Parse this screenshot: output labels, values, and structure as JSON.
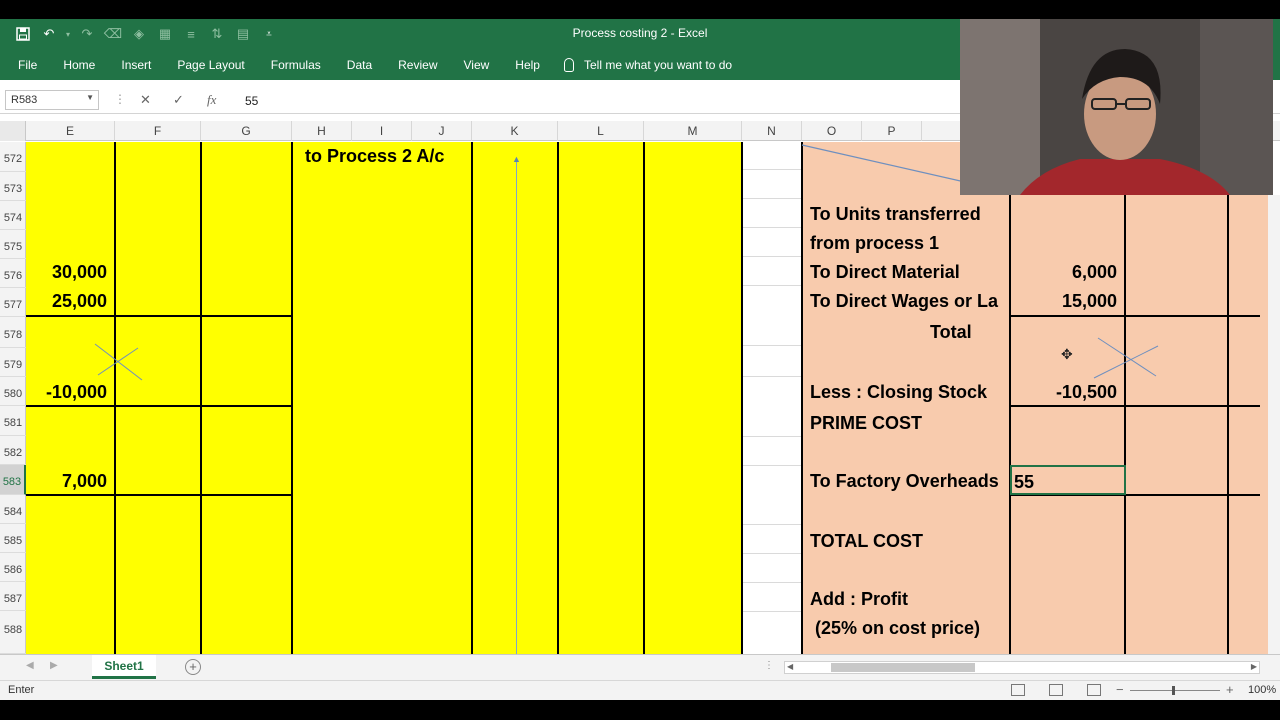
{
  "window": {
    "title": "Process costing 2  -  Excel"
  },
  "ribbon": {
    "tabs": [
      "File",
      "Home",
      "Insert",
      "Page Layout",
      "Formulas",
      "Data",
      "Review",
      "View",
      "Help"
    ],
    "tell_me": "Tell me what you want to do"
  },
  "formula_bar": {
    "name_box": "R583",
    "cancel": "✕",
    "enter": "✓",
    "fx": "fx",
    "value": "55"
  },
  "columns": [
    "E",
    "F",
    "G",
    "H",
    "I",
    "J",
    "K",
    "L",
    "M",
    "N",
    "O",
    "P"
  ],
  "rows": [
    "572",
    "573",
    "574",
    "575",
    "576",
    "577",
    "578",
    "579",
    "580",
    "581",
    "582",
    "583",
    "584",
    "585",
    "586",
    "587",
    "588"
  ],
  "left_table": {
    "heading": "to Process 2 A/c",
    "values": {
      "r576": "30,000",
      "r577": "25,000",
      "r580": "-10,000",
      "r583": "7,000"
    }
  },
  "right_table": {
    "labels": {
      "units_transferred_1": "To Units transferred",
      "units_transferred_2": "from process 1",
      "direct_material": "To Direct Material",
      "direct_wages": "To Direct Wages or La",
      "total": "Total",
      "closing_stock": "Less : Closing Stock",
      "prime_cost": "PRIME COST",
      "factory_overheads": "To Factory Overheads",
      "total_cost": "TOTAL COST",
      "add_profit": "Add : Profit",
      "profit_note": " (25% on cost price)"
    },
    "values": {
      "direct_material": "6,000",
      "direct_wages": "15,000",
      "closing_stock": "-10,500",
      "factory_overheads": "55"
    }
  },
  "sheets": {
    "active": "Sheet1",
    "add": "+"
  },
  "status": {
    "mode": "Enter",
    "zoom": "100%"
  },
  "colors": {
    "excel_green": "#217346",
    "yellow_fill": "#ffff00",
    "peach_fill": "#f8cbad"
  }
}
